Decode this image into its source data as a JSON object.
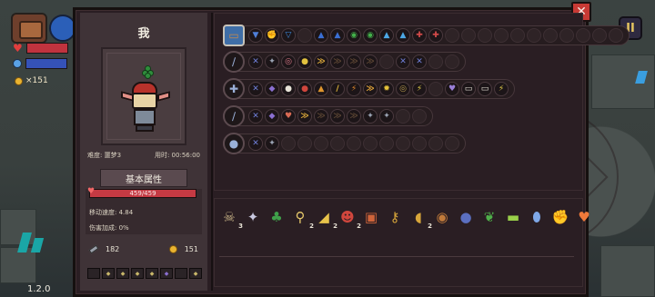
{
  "hud": {
    "gold": "151",
    "version": "1.2.0"
  },
  "panel": {
    "title": "我",
    "difficulty": "难度: 噩梦3",
    "time_used": "用时: 00:56:00",
    "attr_tab": "基本属性",
    "hp_text": "459/459",
    "move_speed": "移动速度: 4.84",
    "damage_bonus": "伤害加成: 0%",
    "keys": "182",
    "coins": "151",
    "close_glyph": "✕",
    "pause_glyph": "II"
  },
  "colors": {
    "accent_red": "#c83a35",
    "panel_bg": "#2a1e23",
    "hp": "#c53a43"
  },
  "equipment_rows": [
    {
      "lead_icon": "chest-icon",
      "lead_glyph": "▭",
      "icons": [
        {
          "name": "blue-triangle-icon",
          "glyph": "▼",
          "color": "#4f7fd8"
        },
        {
          "name": "red-fist-icon",
          "glyph": "✊",
          "color": "#c4463c"
        },
        {
          "name": "blue-tri-icon",
          "glyph": "▽",
          "color": "#3e8ce0"
        },
        {
          "name": "empty",
          "glyph": "",
          "color": ""
        },
        {
          "name": "blue-hat-icon",
          "glyph": "▲",
          "color": "#3a6fd4"
        },
        {
          "name": "blue-hat-icon",
          "glyph": "▲",
          "color": "#3a6fd4"
        },
        {
          "name": "green-swirl-icon",
          "glyph": "◉",
          "color": "#43b04a"
        },
        {
          "name": "green-swirl-icon",
          "glyph": "◉",
          "color": "#43b04a"
        },
        {
          "name": "blue-flame-icon",
          "glyph": "▲",
          "color": "#4ca8e6"
        },
        {
          "name": "blue-flame-icon",
          "glyph": "▲",
          "color": "#4ca8e6"
        },
        {
          "name": "red-cross-icon",
          "glyph": "✚",
          "color": "#d34a4a"
        },
        {
          "name": "red-cross-icon",
          "glyph": "✚",
          "color": "#d34a4a"
        }
      ],
      "empties": 11
    },
    {
      "lead_icon": "wand-icon",
      "lead_glyph": "∕",
      "icons": [
        {
          "name": "crossed-blades-icon",
          "glyph": "✕",
          "color": "#6f7fd8"
        },
        {
          "name": "gray-gear-icon",
          "glyph": "✦",
          "color": "#9aa3b3"
        },
        {
          "name": "pink-target-icon",
          "glyph": "◎",
          "color": "#e07a8a"
        },
        {
          "name": "yellow-orb-icon",
          "glyph": "●",
          "color": "#e3c23f"
        },
        {
          "name": "wing-icon",
          "glyph": "≫",
          "color": "#d8a63a"
        },
        {
          "name": "empty-rune-icon",
          "glyph": "≫",
          "color": "#5a4432"
        },
        {
          "name": "empty-rune-icon",
          "glyph": "≫",
          "color": "#5a4432"
        },
        {
          "name": "empty-rune-icon",
          "glyph": "≫",
          "color": "#5a4432"
        },
        {
          "name": "empty",
          "glyph": "",
          "color": ""
        },
        {
          "name": "crossed-blades-icon",
          "glyph": "✕",
          "color": "#6f7fd8"
        },
        {
          "name": "crossed-blades-icon",
          "glyph": "✕",
          "color": "#6f7fd8"
        }
      ],
      "empties": 2
    },
    {
      "lead_icon": "staff-icon",
      "lead_glyph": "✚",
      "icons": [
        {
          "name": "crossed-blades-icon",
          "glyph": "✕",
          "color": "#6f7fd8"
        },
        {
          "name": "purple-bird-icon",
          "glyph": "◆",
          "color": "#8a6fd0"
        },
        {
          "name": "white-glove-icon",
          "glyph": "●",
          "color": "#e8e4d8"
        },
        {
          "name": "red-bomb-icon",
          "glyph": "●",
          "color": "#d0463d"
        },
        {
          "name": "fire-icon",
          "glyph": "▲",
          "color": "#e0962e"
        },
        {
          "name": "gold-sword-icon",
          "glyph": "∕",
          "color": "#e3b83a"
        },
        {
          "name": "orange-bolt-icon",
          "glyph": "⚡",
          "color": "#e58a2a"
        },
        {
          "name": "arrows-icon",
          "glyph": "≫",
          "color": "#e0a33a"
        },
        {
          "name": "sun-icon",
          "glyph": "✹",
          "color": "#e5c33a"
        },
        {
          "name": "ring-icon",
          "glyph": "◎",
          "color": "#b69a4a"
        },
        {
          "name": "lightning-icon",
          "glyph": "⚡",
          "color": "#e8d24a"
        },
        {
          "name": "empty",
          "glyph": "",
          "color": ""
        },
        {
          "name": "purple-heart-icon",
          "glyph": "♥",
          "color": "#9a7fd8"
        },
        {
          "name": "white-book-icon",
          "glyph": "▭",
          "color": "#e8e4d8"
        },
        {
          "name": "white-book-icon",
          "glyph": "▭",
          "color": "#e8e4d8"
        },
        {
          "name": "bolt-card-icon",
          "glyph": "⚡",
          "color": "#e8d24a"
        }
      ],
      "empties": 0
    },
    {
      "lead_icon": "dark-wand-icon",
      "lead_glyph": "∕",
      "icons": [
        {
          "name": "crossed-blades-icon",
          "glyph": "✕",
          "color": "#6f7fd8"
        },
        {
          "name": "purple-bird-icon",
          "glyph": "◆",
          "color": "#8a6fd0"
        },
        {
          "name": "heart-bow-icon",
          "glyph": "♥",
          "color": "#d86a54"
        },
        {
          "name": "wing-icon",
          "glyph": "≫",
          "color": "#d8a63a"
        },
        {
          "name": "empty-rune-icon",
          "glyph": "≫",
          "color": "#5a4432"
        },
        {
          "name": "empty-rune-icon",
          "glyph": "≫",
          "color": "#5a4432"
        },
        {
          "name": "empty-rune-icon",
          "glyph": "≫",
          "color": "#5a4432"
        },
        {
          "name": "gray-gear-icon",
          "glyph": "✦",
          "color": "#9aa3b3"
        },
        {
          "name": "gray-gear-icon",
          "glyph": "✦",
          "color": "#9aa3b3"
        }
      ],
      "empties": 2
    },
    {
      "lead_icon": "mace-icon",
      "lead_glyph": "●",
      "icons": [
        {
          "name": "crossed-blades-icon",
          "glyph": "✕",
          "color": "#6f7fd8"
        },
        {
          "name": "gray-gear-icon",
          "glyph": "✦",
          "color": "#9aa3b3"
        }
      ],
      "empties": 11
    }
  ],
  "items": [
    {
      "name": "skull-icon",
      "glyph": "☠",
      "color": "#c9b487",
      "count": "3"
    },
    {
      "name": "white-bird-icon",
      "glyph": "✦",
      "color": "#c9c9e0",
      "count": ""
    },
    {
      "name": "clover-icon",
      "glyph": "♣",
      "color": "#3fa04a",
      "count": ""
    },
    {
      "name": "magnifier-icon",
      "glyph": "⚲",
      "color": "#e6c86a",
      "count": "2"
    },
    {
      "name": "cheese-icon",
      "glyph": "◢",
      "color": "#e8c34a",
      "count": "2"
    },
    {
      "name": "demon-mask-icon",
      "glyph": "☻",
      "color": "#d0463d",
      "count": "2"
    },
    {
      "name": "scroll-icon",
      "glyph": "▣",
      "color": "#d0643a",
      "count": ""
    },
    {
      "name": "key-icon",
      "glyph": "⚷",
      "color": "#d8a63a",
      "count": ""
    },
    {
      "name": "bread-icon",
      "glyph": "◖",
      "color": "#d8a63a",
      "count": "2"
    },
    {
      "name": "hammer-icon",
      "glyph": "◉",
      "color": "#c07a3a",
      "count": ""
    },
    {
      "name": "dark-orb-icon",
      "glyph": "●",
      "color": "#5b6fc0",
      "count": ""
    },
    {
      "name": "green-leaf-icon",
      "glyph": "❦",
      "color": "#4fb04a",
      "count": ""
    },
    {
      "name": "green-bone-icon",
      "glyph": "▬",
      "color": "#9ad04a",
      "count": ""
    },
    {
      "name": "blue-egg-icon",
      "glyph": "⬮",
      "color": "#7fa8e8",
      "count": ""
    },
    {
      "name": "yellow-fist-icon",
      "glyph": "✊",
      "color": "#e0b03a",
      "count": ""
    },
    {
      "name": "orange-heart-icon",
      "glyph": "♥",
      "color": "#f07a3a",
      "count": ""
    }
  ]
}
